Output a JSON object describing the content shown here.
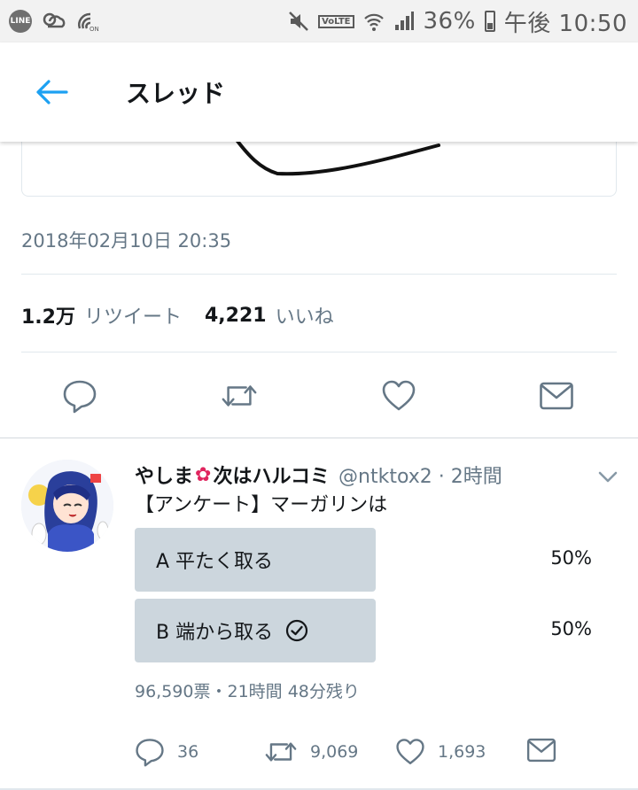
{
  "status_bar": {
    "line_badge": "LINE",
    "volte": "VoLTE",
    "battery": "36%",
    "clock": "午後 10:50"
  },
  "header": {
    "title": "スレッド"
  },
  "tweet": {
    "timestamp": "2018年02月10日 20:35",
    "retweet_count": "1.2万",
    "retweet_label": "リツイート",
    "like_count": "4,221",
    "like_label": "いいね"
  },
  "reply": {
    "author_name_1": "やしま",
    "author_name_2": "次はハルコミ",
    "handle": "@ntktox2 · 2時間",
    "text": "【アンケート】マーガリンは",
    "poll": {
      "options": [
        {
          "label": "A 平たく取る",
          "percent": "50%",
          "fraction": 0.5,
          "selected": false
        },
        {
          "label": "B 端から取る",
          "percent": "50%",
          "fraction": 0.5,
          "selected": true
        }
      ],
      "meta": "96,590票・21時間 48分残り"
    },
    "actions": {
      "replies": "36",
      "retweets": "9,069",
      "likes": "1,693"
    }
  },
  "colors": {
    "accent": "#1da1f2",
    "secondary_text": "#657786",
    "poll_bar": "#ccd6dd"
  }
}
